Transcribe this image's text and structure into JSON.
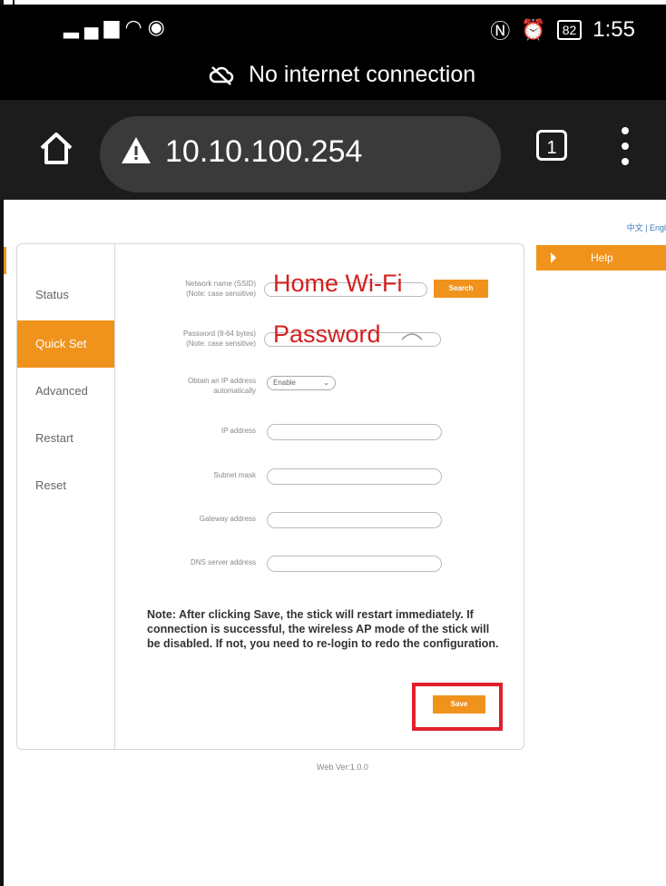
{
  "status_bar": {
    "left_icons": [
      "signal-icon",
      "wifi-icon",
      "eye-icon"
    ],
    "right_icons": [
      "nfc-icon",
      "alarm-icon"
    ],
    "battery": "82",
    "time": "1:55"
  },
  "connection": {
    "text": "No internet connection"
  },
  "browser": {
    "url": "10.10.100.254",
    "tab_count": "1"
  },
  "page": {
    "lang_links": "中文 | Engl",
    "sidebar": {
      "items": [
        {
          "label": "Status",
          "active": false
        },
        {
          "label": "Quick Set",
          "active": true
        },
        {
          "label": "Advanced",
          "active": false
        },
        {
          "label": "Restart",
          "active": false
        },
        {
          "label": "Reset",
          "active": false
        }
      ]
    },
    "form": {
      "ssid_label": "Network name (SSID)\n(Note: case sensitive)",
      "ssid_value": "Home Wi-Fi",
      "search_label": "Search",
      "password_label": "Password (8-64 bytes)\n(Note: case sensitive)",
      "password_value": "Password",
      "dhcp_label": "Obtain an IP address\nautomatically",
      "dhcp_value": "Enable",
      "ip_label": "IP address",
      "subnet_label": "Subnet mask",
      "gateway_label": "Gateway address",
      "dns_label": "DNS server address",
      "note": "Note: After clicking Save, the stick will restart immediately. If connection is successful, the wireless AP mode of the stick will be disabled. If not, you need to re-login to redo the configuration.",
      "save_label": "Save"
    },
    "help_label": "Help",
    "web_version": "Web Ver:1.0.0"
  },
  "colors": {
    "accent": "#f0931c",
    "annotation": "#e0202a"
  }
}
